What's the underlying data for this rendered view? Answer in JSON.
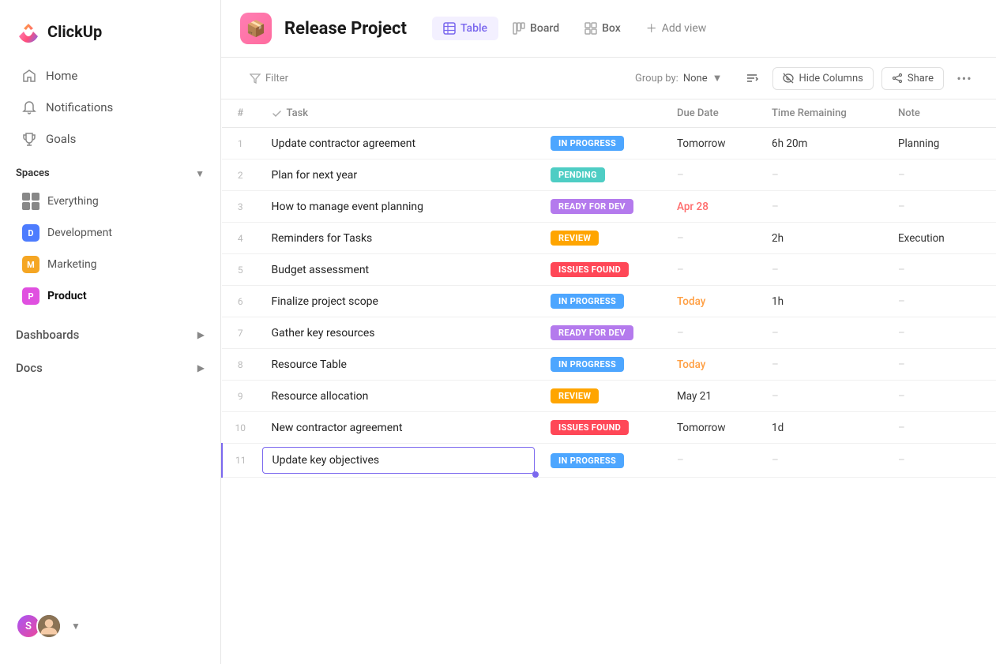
{
  "app": {
    "name": "ClickUp"
  },
  "sidebar": {
    "nav": [
      {
        "id": "home",
        "label": "Home",
        "icon": "home"
      },
      {
        "id": "notifications",
        "label": "Notifications",
        "icon": "bell"
      },
      {
        "id": "goals",
        "label": "Goals",
        "icon": "trophy"
      }
    ],
    "spaces_label": "Spaces",
    "spaces": [
      {
        "id": "everything",
        "label": "Everything",
        "type": "everything"
      },
      {
        "id": "development",
        "label": "Development",
        "type": "avatar",
        "color": "#4d7cfe",
        "initial": "D"
      },
      {
        "id": "marketing",
        "label": "Marketing",
        "type": "avatar",
        "color": "#f5a623",
        "initial": "M"
      },
      {
        "id": "product",
        "label": "Product",
        "type": "avatar",
        "color": "#e050e0",
        "initial": "P",
        "active": true
      }
    ],
    "expandable": [
      {
        "id": "dashboards",
        "label": "Dashboards",
        "expanded": false
      },
      {
        "id": "docs",
        "label": "Docs",
        "expanded": false
      }
    ],
    "user": {
      "initials": "S",
      "color": "#7b68ee"
    }
  },
  "header": {
    "project_icon": "📦",
    "project_title": "Release Project",
    "views": [
      {
        "id": "table",
        "label": "Table",
        "active": true,
        "icon": "table"
      },
      {
        "id": "board",
        "label": "Board",
        "active": false,
        "icon": "board"
      },
      {
        "id": "box",
        "label": "Box",
        "active": false,
        "icon": "box"
      }
    ],
    "add_view_label": "Add view"
  },
  "toolbar": {
    "filter_label": "Filter",
    "group_by_prefix": "Group by:",
    "group_by_value": "None",
    "hide_columns_label": "Hide Columns",
    "share_label": "Share"
  },
  "table": {
    "columns": [
      {
        "id": "num",
        "label": "#"
      },
      {
        "id": "task",
        "label": "Task"
      },
      {
        "id": "status",
        "label": ""
      },
      {
        "id": "due_date",
        "label": "Due Date"
      },
      {
        "id": "time_remaining",
        "label": "Time Remaining"
      },
      {
        "id": "note",
        "label": "Note"
      }
    ],
    "rows": [
      {
        "num": 1,
        "task": "Update contractor agreement",
        "status": "IN PROGRESS",
        "status_type": "in-progress",
        "due_date": "Tomorrow",
        "due_type": "normal",
        "time_remaining": "6h 20m",
        "note": "Planning"
      },
      {
        "num": 2,
        "task": "Plan for next year",
        "status": "PENDING",
        "status_type": "pending",
        "due_date": "–",
        "due_type": "dash",
        "time_remaining": "–",
        "note": "–"
      },
      {
        "num": 3,
        "task": "How to manage event planning",
        "status": "READY FOR DEV",
        "status_type": "ready-for-dev",
        "due_date": "Apr 28",
        "due_type": "overdue",
        "time_remaining": "–",
        "note": "–"
      },
      {
        "num": 4,
        "task": "Reminders for Tasks",
        "status": "REVIEW",
        "status_type": "review",
        "due_date": "–",
        "due_type": "dash",
        "time_remaining": "2h",
        "note": "Execution"
      },
      {
        "num": 5,
        "task": "Budget assessment",
        "status": "ISSUES FOUND",
        "status_type": "issues-found",
        "due_date": "–",
        "due_type": "dash",
        "time_remaining": "–",
        "note": "–"
      },
      {
        "num": 6,
        "task": "Finalize project scope",
        "status": "IN PROGRESS",
        "status_type": "in-progress",
        "due_date": "Today",
        "due_type": "today",
        "time_remaining": "1h",
        "note": "–"
      },
      {
        "num": 7,
        "task": "Gather key resources",
        "status": "READY FOR DEV",
        "status_type": "ready-for-dev",
        "due_date": "–",
        "due_type": "dash",
        "time_remaining": "–",
        "note": "–"
      },
      {
        "num": 8,
        "task": "Resource Table",
        "status": "IN PROGRESS",
        "status_type": "in-progress",
        "due_date": "Today",
        "due_type": "today",
        "time_remaining": "–",
        "note": "–"
      },
      {
        "num": 9,
        "task": "Resource allocation",
        "status": "REVIEW",
        "status_type": "review",
        "due_date": "May 21",
        "due_type": "normal",
        "time_remaining": "–",
        "note": "–"
      },
      {
        "num": 10,
        "task": "New contractor agreement",
        "status": "ISSUES FOUND",
        "status_type": "issues-found",
        "due_date": "Tomorrow",
        "due_type": "normal",
        "time_remaining": "1d",
        "note": "–"
      },
      {
        "num": 11,
        "task": "Update key objectives",
        "status": "IN PROGRESS",
        "status_type": "in-progress",
        "due_date": "–",
        "due_type": "dash",
        "time_remaining": "–",
        "note": "–",
        "selected": true
      }
    ]
  }
}
